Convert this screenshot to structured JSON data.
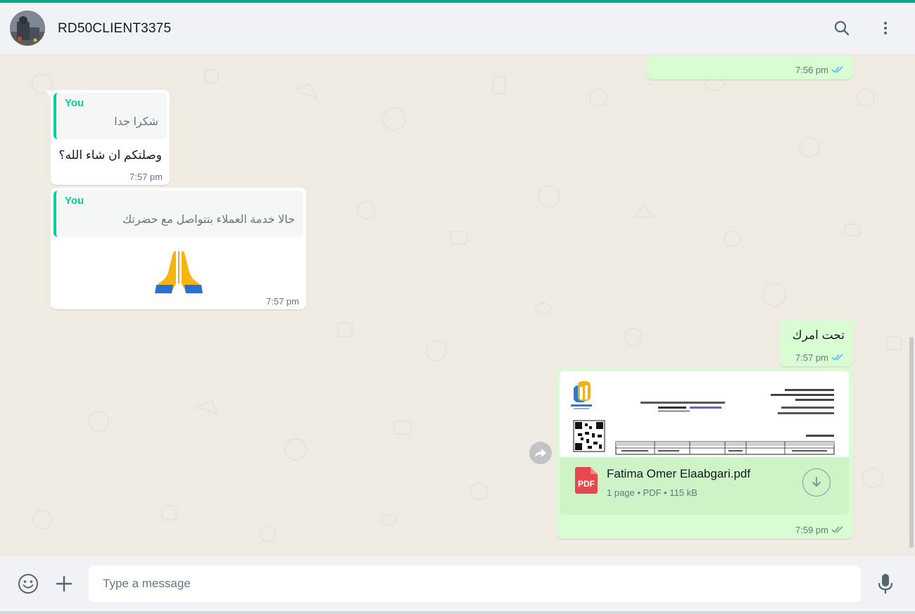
{
  "header": {
    "contact_name": "RD50CLIENT3375",
    "icons": [
      "search-icon",
      "menu-kebab-icon"
    ]
  },
  "messages": [
    {
      "direction": "outgoing",
      "partial": true,
      "time": "7:56 pm",
      "status": "read"
    },
    {
      "direction": "incoming",
      "quote": {
        "author": "You",
        "text": "شكرا جدا"
      },
      "text": "وصلتكم ان شاء الله؟",
      "time": "7:57 pm"
    },
    {
      "direction": "incoming",
      "quote": {
        "author": "You",
        "text": "حالا خدمة العملاء بتتواصل مع حضرتك"
      },
      "text": "🙏",
      "time": "7:57 pm"
    },
    {
      "direction": "outgoing",
      "text": "تحت امرك",
      "time": "7:57 pm",
      "status": "read"
    },
    {
      "direction": "outgoing",
      "type": "document",
      "file_name": "Fatima Omer Elaabgari.pdf",
      "file_meta": "1 page • PDF • 115 kB",
      "file_badge": "PDF",
      "time": "7:59 pm",
      "status": "read"
    }
  ],
  "composer": {
    "placeholder": "Type a message",
    "icons": [
      "emoji-icon",
      "plus-icon",
      "microphone-icon"
    ]
  },
  "colors": {
    "accent": "#00a884",
    "incoming_bubble": "#ffffff",
    "outgoing_bubble": "#d9fdd3",
    "read_ticks": "#53bdeb",
    "background": "#efeae2"
  }
}
